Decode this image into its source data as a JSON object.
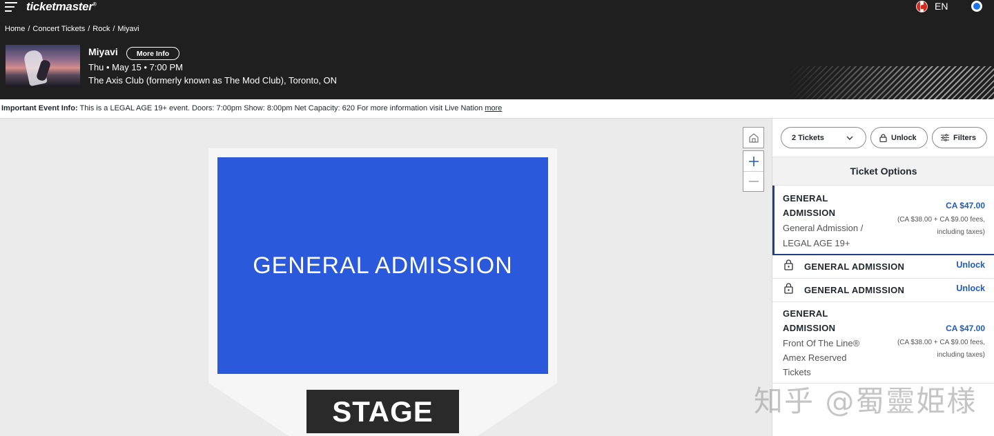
{
  "header": {
    "logo": "ticketmaster",
    "logo_mark": "®",
    "language": "EN",
    "flag_icon": "canada-flag-icon",
    "breadcrumb": [
      "Home",
      "Concert Tickets",
      "Rock",
      "Miyavi"
    ],
    "breadcrumb_sep": "/",
    "event": {
      "name": "Miyavi",
      "more_info_label": "More Info",
      "date": "Thu • May 15 • 7:00 PM",
      "venue": "The Axis Club (formerly known as The Mod Club), Toronto, ON"
    }
  },
  "info_bar": {
    "label": "Important Event Info:",
    "text": "This is a LEGAL AGE 19+ event. Doors: 7:00pm Show: 8:00pm Net Capacity: 620 For more information visit Live Nation",
    "more_link": "more"
  },
  "map": {
    "section_label": "GENERAL ADMISSION",
    "stage_label": "STAGE",
    "section_color": "#2b59db"
  },
  "panel": {
    "quantity": "2 Tickets",
    "unlock_label": "Unlock",
    "filters_label": "Filters",
    "options_title": "Ticket Options",
    "rows": [
      {
        "section_line1": "GENERAL",
        "section_line2": "ADMISSION",
        "desc_line1": "General Admission /",
        "desc_line2": "LEGAL AGE 19+",
        "price": "CA $47.00",
        "fees_line1": "(CA $38.00 + CA $9.00 fees,",
        "fees_line2": "including taxes)"
      },
      {
        "section": "GENERAL ADMISSION",
        "action": "Unlock"
      },
      {
        "section": "GENERAL ADMISSION",
        "action": "Unlock"
      },
      {
        "section_line1": "GENERAL",
        "section_line2": "ADMISSION",
        "desc_line1": "Front Of The Line®",
        "desc_line2": "Amex Reserved",
        "desc_line3": "Tickets ",
        "price": "CA $47.00",
        "fees_line1": "(CA $38.00 + CA $9.00 fees,",
        "fees_line2": "including taxes)"
      }
    ]
  },
  "watermark": "知乎 @蜀靈姫様"
}
